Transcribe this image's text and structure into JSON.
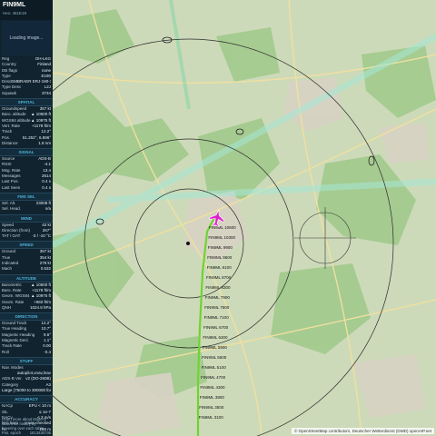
{
  "aircraft": {
    "callsign": "FIN9ML",
    "hex_label": "Hex: 461E18",
    "photo_status": "Loading image..."
  },
  "info_rows": [
    {
      "label": "Reg",
      "value": "OH-LKG"
    },
    {
      "label": "Country",
      "value": "Finland"
    },
    {
      "label": "DB flags",
      "value": "none"
    },
    {
      "label": "Type",
      "value": "E190"
    },
    {
      "label": "Desc",
      "value": "EMBRAER ERJ-190-100"
    },
    {
      "label": "Type Desc",
      "value": "L2J"
    },
    {
      "label": "Squawk",
      "value": "3734"
    }
  ],
  "sections": [
    {
      "title": "SPATIAL",
      "rows": [
        {
          "label": "Groundspeed",
          "value": "357 kt"
        },
        {
          "label": "Baro. altitude",
          "value": "▲ 10600 ft"
        },
        {
          "label": "WGS84 altitude",
          "value": "▲ 10975 ft"
        },
        {
          "label": "Vert. Rate",
          "value": "+1178 ft/m"
        },
        {
          "label": "Track",
          "value": "12.2°"
        },
        {
          "label": "Pos.",
          "value": "51.252°, 6.896°"
        },
        {
          "label": "Distance",
          "value": "1.8 nm"
        }
      ]
    },
    {
      "title": "SIGNAL",
      "rows": [
        {
          "label": "Source",
          "value": "ADS-B"
        },
        {
          "label": "RSSI",
          "value": "-4.1"
        },
        {
          "label": "Msg. Rate",
          "value": "13.4"
        },
        {
          "label": "Messages",
          "value": "2614"
        },
        {
          "label": "Last Pos.",
          "value": "0.4 s"
        },
        {
          "label": "Last Seen",
          "value": "0.4 s"
        }
      ]
    },
    {
      "title": "FMS SEL",
      "rows": [
        {
          "label": "Sel. Alt.",
          "value": "23008 ft"
        },
        {
          "label": "Sel. Head.",
          "value": "n/a"
        }
      ]
    },
    {
      "title": "WIND",
      "rows": [
        {
          "label": "Speed",
          "value": "42 kt"
        },
        {
          "label": "Direction (from)",
          "value": "267°"
        },
        {
          "label": "TAT / OAT",
          "value": "-3 / -10 °C"
        }
      ]
    },
    {
      "title": "SPEED",
      "rows": [
        {
          "label": "Ground",
          "value": "357 kt"
        },
        {
          "label": "True",
          "value": "354 kt"
        },
        {
          "label": "Indicated",
          "value": "279 kt"
        },
        {
          "label": "Mach",
          "value": "0.532"
        }
      ]
    },
    {
      "title": "ALTITUDE",
      "rows": [
        {
          "label": "Barometric",
          "value": "▲ 10600 ft"
        },
        {
          "label": "Baro. Rate",
          "value": "+1178 ft/m"
        },
        {
          "label": "Geom. WGS84",
          "value": "▲ 10975 ft"
        },
        {
          "label": "Geom. Rate",
          "value": "+960 ft/m"
        },
        {
          "label": "QNH",
          "value": "1024.8 hPa"
        }
      ]
    },
    {
      "title": "DIRECTION",
      "rows": [
        {
          "label": "Ground Track",
          "value": "12.2°"
        },
        {
          "label": "True Heading",
          "value": "10.7°"
        },
        {
          "label": "Magnetic Heading",
          "value": "9.6°"
        },
        {
          "label": "Magnetic Decl.",
          "value": "1.1°"
        },
        {
          "label": "Track Rate",
          "value": "0.00"
        },
        {
          "label": "Roll",
          "value": "-0.4"
        }
      ]
    },
    {
      "title": "STUFF",
      "rows": [
        {
          "label": "Nav. Modes",
          "value": ""
        },
        {
          "label": "",
          "value": "autopilot,vnav,lnav"
        },
        {
          "label": "ADS-B Ver.",
          "value": "v2 (DO-260B)"
        },
        {
          "label": "Category",
          "value": "A3"
        },
        {
          "label": "",
          "value": "Large (75000 to 300000 lbs)"
        }
      ]
    },
    {
      "title": "ACCURACY",
      "rows": [
        {
          "label": "NACp",
          "value": "EPU < 10 m"
        },
        {
          "label": "SIL",
          "value": "≤ 1e-7"
        },
        {
          "label": "NACv",
          "value": "< 3 m/s"
        },
        {
          "label": "NIC baro",
          "value": "cross-checked"
        },
        {
          "label": "Rc",
          "value": "186 m"
        }
      ]
    }
  ],
  "footer": {
    "hint": "Learn more about Mode-S stats from history by hovering over each table",
    "pos_epoch_label": "Pos. epoch",
    "pos_epoch_value": "1613430736"
  },
  "map": {
    "attribution": "© OpenStreetMap contributors, Deutscher Wetterdienst (DWD) openAIP.net",
    "aircraft_color": "#e020c8",
    "track_color": "#6fd430",
    "track_labels": [
      "FIN9ML 10600",
      "FIN9ML 10300",
      "FIN9ML 9900",
      "FIN9ML 9500",
      "FIN9ML 9100",
      "FIN9ML 8700",
      "FIN9ML 8300",
      "FIN9ML 7900",
      "FIN9ML 7500",
      "FIN9ML 7100",
      "FIN9ML 6700",
      "FIN9ML 6300",
      "FIN9ML 5900",
      "FIN9ML 5500",
      "FIN9ML 5100",
      "FIN9ML 4700",
      "FIN9ML 4300",
      "FIN9ML 3900",
      "FIN9ML 3500",
      "FIN9ML 3100"
    ]
  }
}
